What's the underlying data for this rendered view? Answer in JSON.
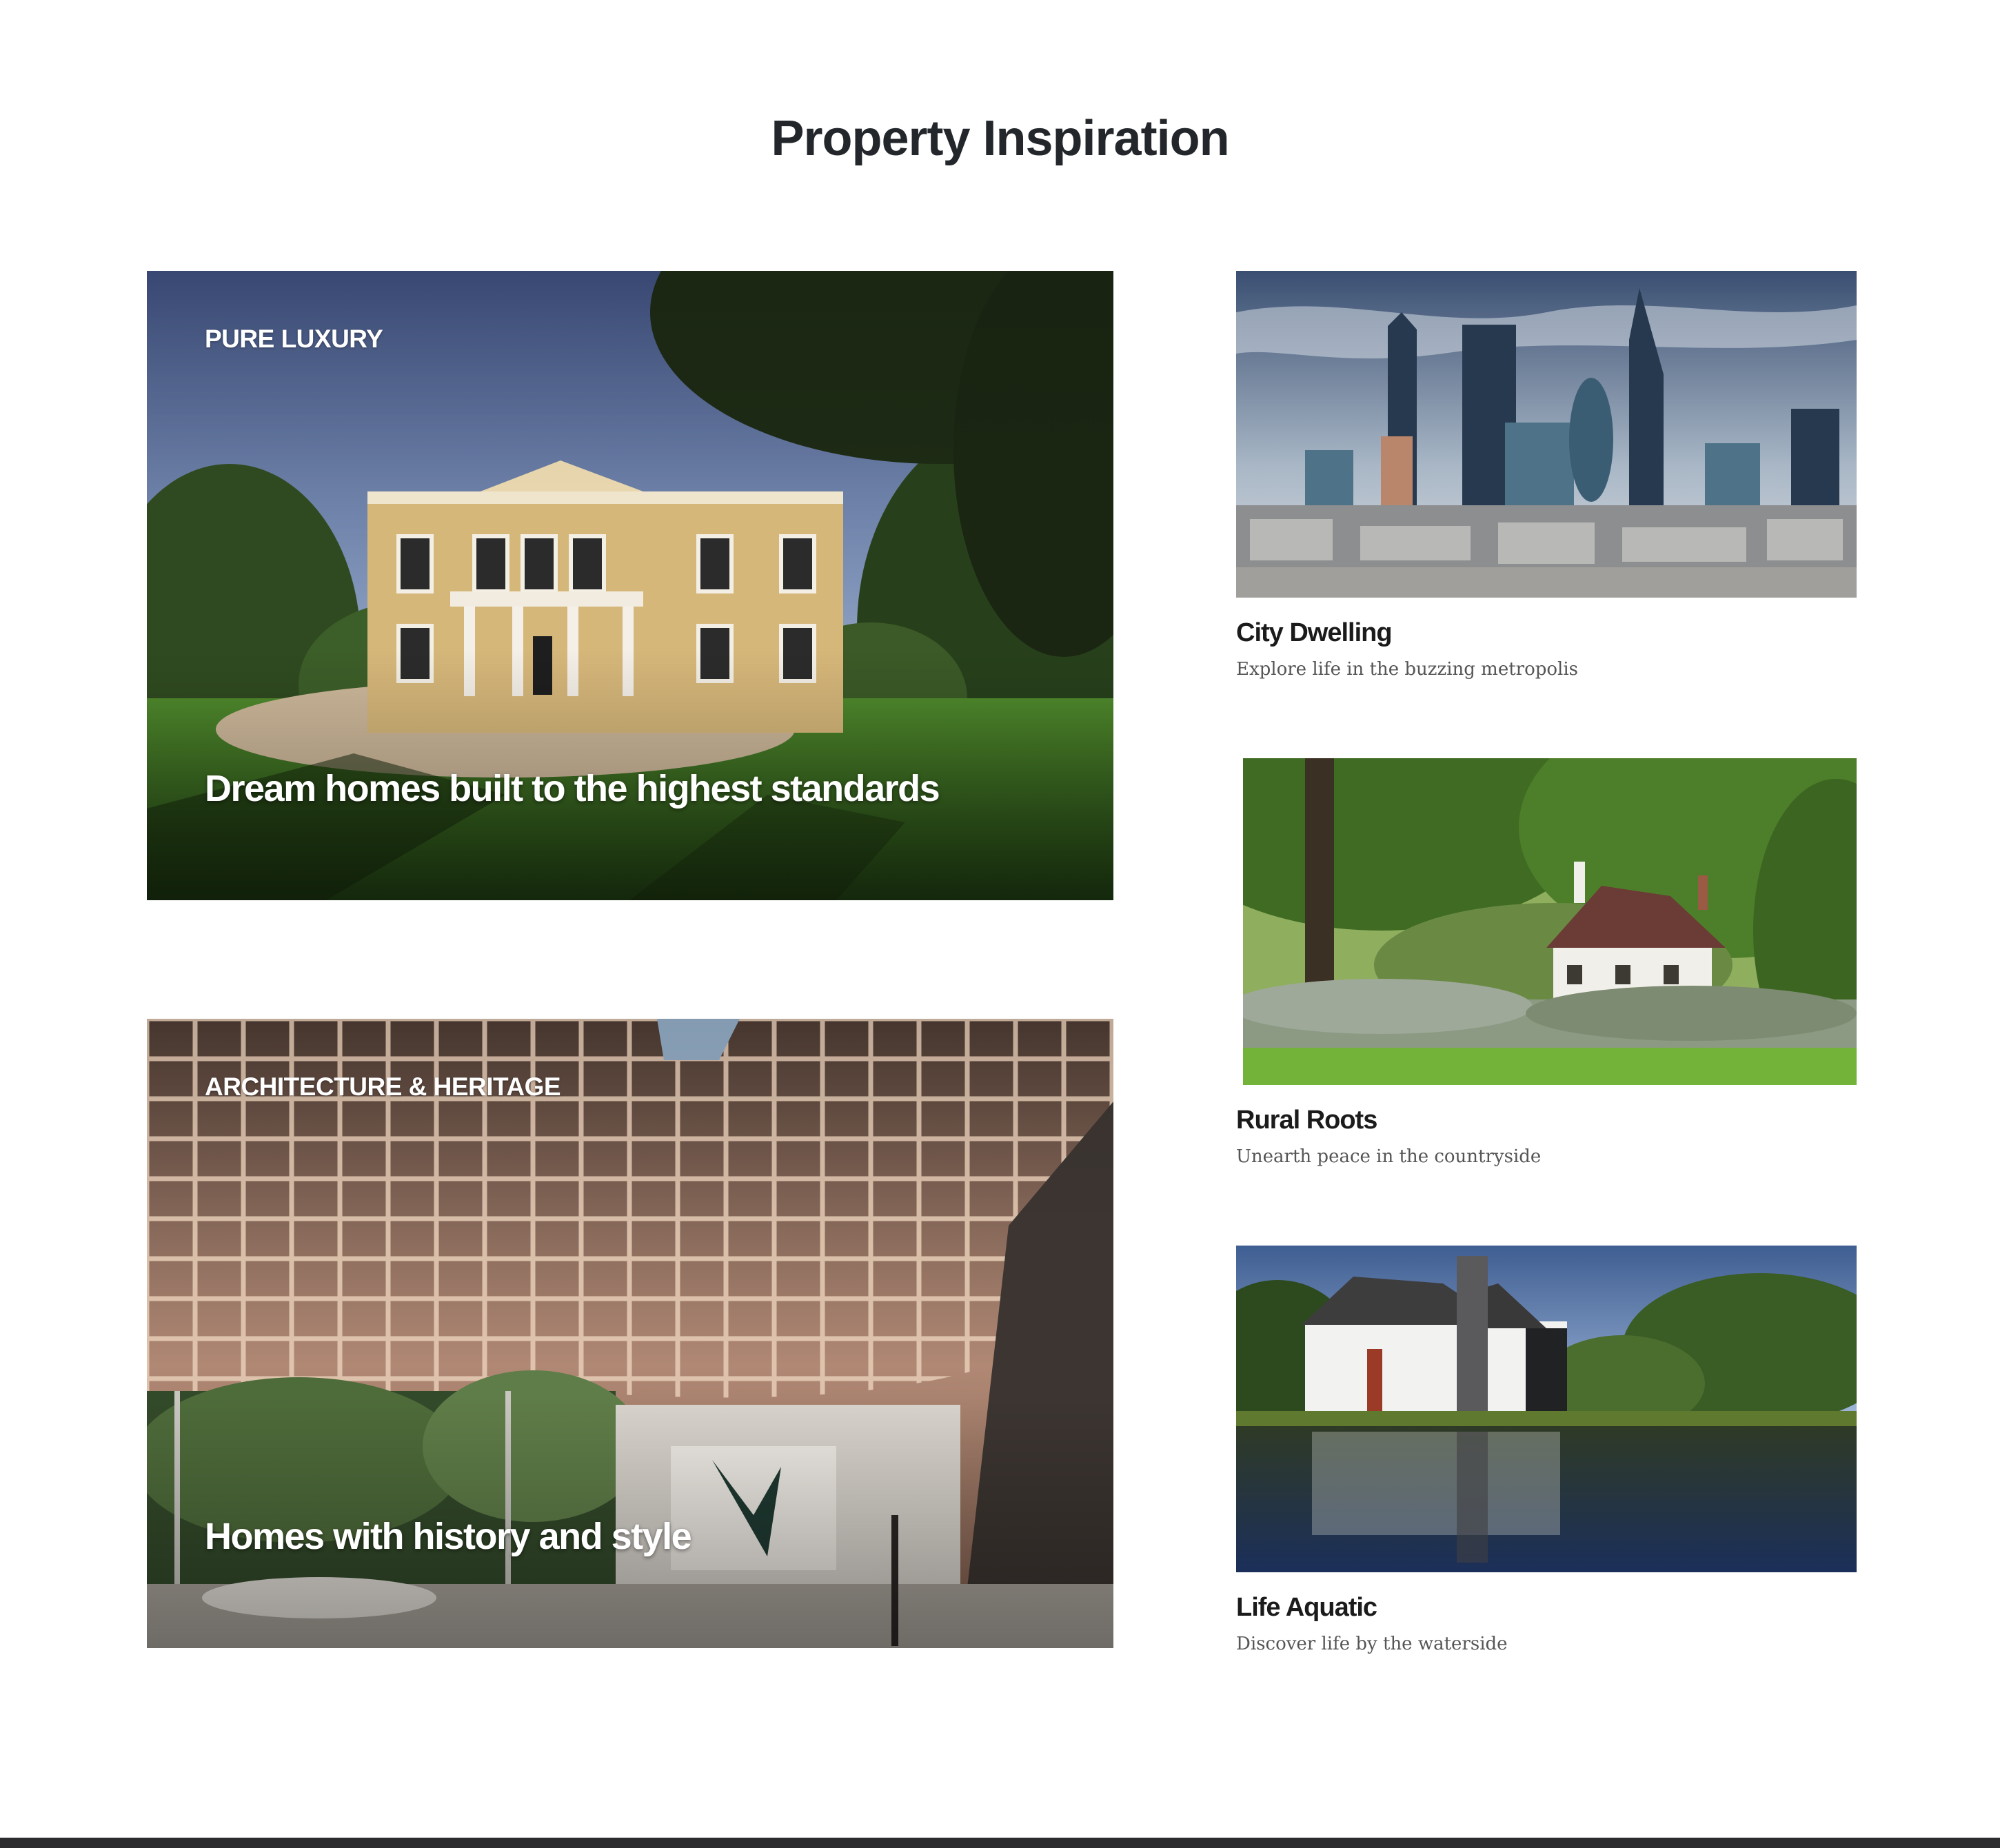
{
  "page": {
    "title": "Property Inspiration"
  },
  "features": [
    {
      "eyebrow": "PURE LUXURY",
      "headline": "Dream homes built to the highest standards",
      "image": "georgian-mansion-photo"
    },
    {
      "eyebrow": "ARCHITECTURE & HERITAGE",
      "headline": "Homes with  history and style",
      "image": "timber-lattice-interior-photo"
    }
  ],
  "categories": [
    {
      "title": "City Dwelling",
      "description": "Explore life in the buzzing metropolis",
      "image": "city-skyline-photo"
    },
    {
      "title": "Rural Roots",
      "description": "Unearth peace in the countryside",
      "image": "country-cottage-photo"
    },
    {
      "title": "Life Aquatic",
      "description": "Discover life by the waterside",
      "image": "lakeside-house-photo"
    }
  ],
  "colors": {
    "title": "#23272b",
    "footer": "#2c2c2e",
    "description": "#555555"
  }
}
